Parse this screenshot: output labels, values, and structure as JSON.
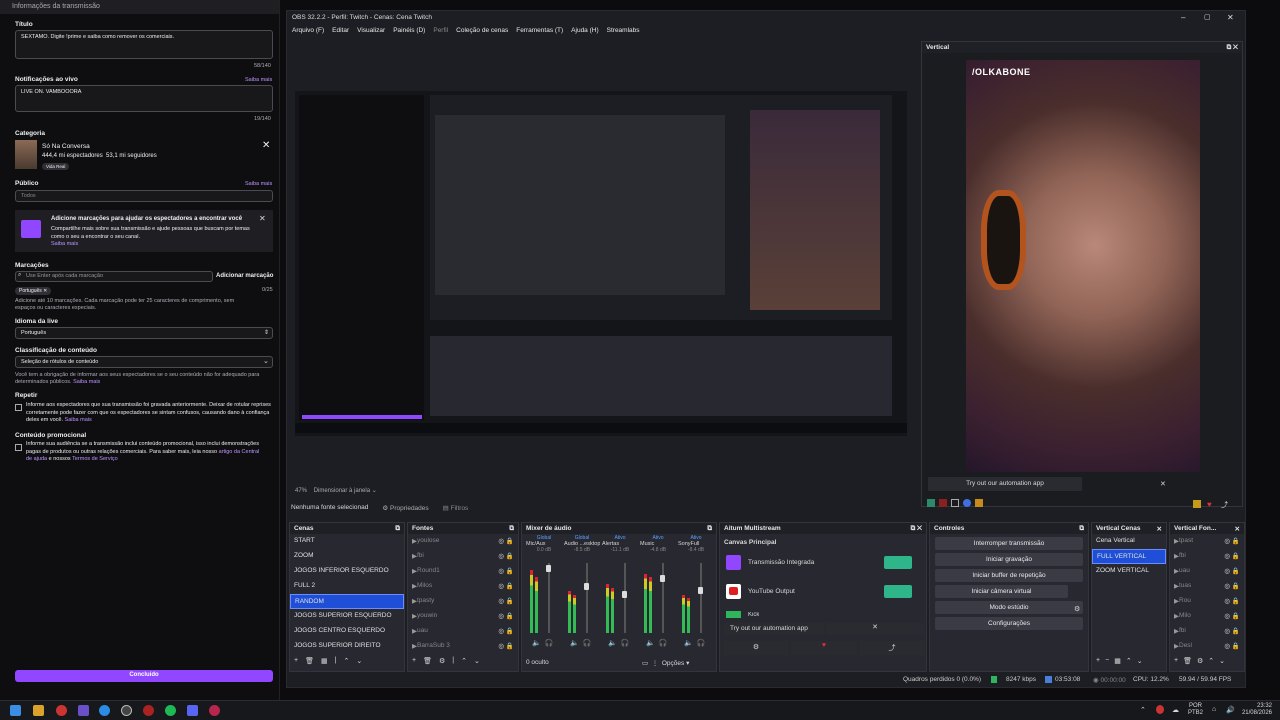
{
  "twitch": {
    "header": "Informações da transmissão",
    "title_label": "Título",
    "title_value": "SEXTAMO. Digite !prime e saiba como remover os comerciais.",
    "title_count": "58/140",
    "notif_label": "Notificações ao vivo",
    "notif_more": "Saiba mais",
    "notif_value": "LIVE ON. VAMBOOORA",
    "notif_count": "19/140",
    "category_label": "Categoria",
    "category_name": "Só Na Conversa",
    "category_viewers": "444,4 mi espectadores",
    "category_followers": "53,1 mi seguidores",
    "category_tag": "Vida Real",
    "public_label": "Público",
    "public_more": "Saiba mais",
    "public_value": "Todos",
    "promo_title": "Adicione marcações para ajudar os espectadores a encontrar você",
    "promo_text": "Compartilhe mais sobre sua transmissão e ajude pessoas que buscam por temas como o seu a encontrar o seu canal.",
    "promo_more": "Saiba mais",
    "tags_label": "Marcações",
    "tags_placeholder": "Use Enter após cada marcação",
    "tags_add": "Adicionar marcação",
    "tags_count": "0/25",
    "tag_chip": "Português",
    "tags_help": "Adicione até 10 marcações. Cada marcação pode ter 25 caracteres de comprimento, sem espaços ou caracteres especiais.",
    "lang_label": "Idioma da live",
    "lang_value": "Português",
    "class_label": "Classificação de conteúdo",
    "class_value": "Seleção de rótulos de conteúdo",
    "class_help": "Você tem a obrigação de informar aos seus espectadores se o seu conteúdo não for adequado para determinados públicos.",
    "class_more": "Saiba mais",
    "rerun_label": "Repetir",
    "rerun_text": "Informe aos espectadores que sua transmissão foi gravada anteriormente. Deixar de rotular reprises corretamente pode fazer com que os espectadores se sintam confusos, causando dano à confiança deles em você.",
    "rerun_more": "Saiba mais",
    "promo2_label": "Conteúdo promocional",
    "promo2_text": "Informe sua audiência se a transmissão inclui conteúdo promocional, isso inclui demonstrações pagas de produtos ou outras relações comerciais. Para saber mais, leia nosso",
    "promo2_link1": "artigo da Central de ajuda",
    "promo2_and": "e nossos",
    "promo2_link2": "Termos de Serviço",
    "done": "Concluído"
  },
  "obs": {
    "title": "OBS 32.2.2 - Perfil: Twitch - Cenas: Cena Twitch",
    "menu": [
      "Arquivo (F)",
      "Editar",
      "Visualizar",
      "Painéis (D)",
      "Perfil",
      "Coleção de cenas",
      "Ferramentas (T)",
      "Ajuda (H)",
      "Streamlabs"
    ],
    "vertical_title": "Vertical",
    "overlay_text": "/OLKABONE",
    "try_auto": "Try out our automation app",
    "zoom": "47%",
    "resize": "Dimensionar à janela",
    "no_source": "Nenhuma fonte selecionad",
    "properties": "Propriedades",
    "filters": "Filtros",
    "scenes_title": "Cenas",
    "scenes": [
      "START",
      "ZOOM",
      "JOGOS INFERIOR ESQUERDO",
      "FULL 2",
      "RANDOM",
      "JOGOS SUPERIOR ESQUERDO",
      "JOGOS CENTRO ESQUERDO",
      "JOGOS SUPERIOR  DIREITO"
    ],
    "sources_title": "Fontes",
    "sources": [
      "youlose",
      "fbi",
      "Round1",
      "Milos",
      "tpasty",
      "youwin",
      "uau",
      "BarraSub 3"
    ],
    "mixer_title": "Mixer de áudio",
    "mixer": [
      {
        "name": "Mic/Aux",
        "tag": "Global",
        "db": "0.0 dB"
      },
      {
        "name": "Áudio ...esktop",
        "tag": "Global",
        "db": "-8.5 dB"
      },
      {
        "name": "Alertas",
        "tag": "Ativo",
        "db": "-11.1 dB"
      },
      {
        "name": "Music",
        "tag": "Ativo",
        "db": "-4.8 dB"
      },
      {
        "name": "SonyFull",
        "tag": "Ativo",
        "db": "-8.4 dB"
      }
    ],
    "hidden": "0 oculto",
    "options": "Opções",
    "multi_title": "Aitum Multistream",
    "canvas": "Canvas Principal",
    "outputs": [
      "Transmissão Integrada",
      "YouTube Output",
      "Kick"
    ],
    "controls_title": "Controles",
    "controls": [
      "Interromper transmissão",
      "Iniciar gravação",
      "Iniciar buffer de repetição",
      "Iniciar câmera virtual",
      "Modo estúdio",
      "Configurações"
    ],
    "vscenes_title": "Vertical Cenas",
    "vscenes": [
      "Cena Vertical",
      "FULL VERTICAL",
      "ZOOM VERTICAL"
    ],
    "vsources_title": "Vertical Fon...",
    "vsources": [
      "tpast",
      "fbi",
      "uau",
      "tuas",
      "Rou",
      "Milo",
      "fbi",
      "Desl"
    ],
    "status": {
      "dropped": "Quadros perdidos 0 (0.0%)",
      "kbps": "8247 kbps",
      "live": "03:53:08",
      "rec": "00:00:00",
      "cpu": "CPU: 12.2%",
      "fps": "59.94 / 59.94 FPS"
    }
  },
  "taskbar": {
    "lang1": "POR",
    "lang2": "PTB2",
    "time": "23:32",
    "date": "21/08/2026"
  },
  "colors": {
    "accent": "#9147ff",
    "select": "#1f4fd6",
    "live_green": "#2fb55c"
  }
}
